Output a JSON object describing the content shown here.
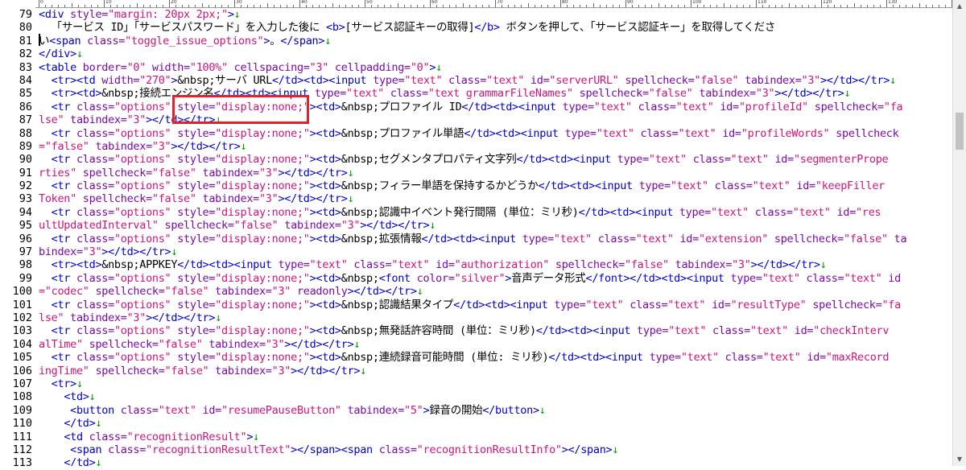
{
  "ruler_labels": [
    "0",
    "10",
    "20",
    "30",
    "40",
    "50",
    "60",
    "70",
    "80",
    "90",
    "100",
    "110",
    "120",
    "130"
  ],
  "line_numbers": [
    "79",
    "80",
    "81",
    "82",
    "83",
    "84",
    "85",
    "86",
    "87",
    "88",
    "89",
    "90",
    "91",
    "92",
    "93",
    "94",
    "95",
    "96",
    "97",
    "98",
    "99",
    "100",
    "101",
    "102",
    "103",
    "104",
    "105",
    "106",
    "107",
    "108",
    "109",
    "110",
    "111",
    "112",
    "113"
  ],
  "colors": {
    "tag": "#0000cc",
    "attr": "#7a0aa8",
    "value": "#d0147a",
    "text": "#000000",
    "eol_arrow": "#00a000",
    "highlight_border": "#e5202e"
  },
  "code_lines": [
    [
      [
        "t",
        "<div"
      ],
      [
        "a",
        " style="
      ],
      [
        "v",
        "\"margin: 20px 2px;\""
      ],
      [
        "t",
        ">"
      ],
      [
        "e",
        "↓"
      ]
    ],
    [
      [
        "x",
        "  「サービス ID」「サービスパスワード」を入力した後に "
      ],
      [
        "t",
        "<b>"
      ],
      [
        "x",
        "[サービス認証キーの取得]"
      ],
      [
        "t",
        "</b>"
      ],
      [
        "x",
        " ボタンを押して、「サービス認証キー」を取得してくださ"
      ]
    ],
    [
      [
        "x",
        "い"
      ],
      [
        "t",
        "<span"
      ],
      [
        "a",
        " class="
      ],
      [
        "v",
        "\"toggle_issue_options\""
      ],
      [
        "t",
        ">"
      ],
      [
        "x",
        "。"
      ],
      [
        "t",
        "</span>"
      ],
      [
        "e",
        "↓"
      ]
    ],
    [
      [
        "t",
        "</div>"
      ],
      [
        "e",
        "↓"
      ]
    ],
    [
      [
        "t",
        "<table"
      ],
      [
        "a",
        " border="
      ],
      [
        "v",
        "\"0\""
      ],
      [
        "a",
        " width="
      ],
      [
        "v",
        "\"100%\""
      ],
      [
        "a",
        " cellspacing="
      ],
      [
        "v",
        "\"3\""
      ],
      [
        "a",
        " cellpadding="
      ],
      [
        "v",
        "\"0\""
      ],
      [
        "t",
        ">"
      ],
      [
        "e",
        "↓"
      ]
    ],
    [
      [
        "x",
        "  "
      ],
      [
        "t",
        "<tr><td"
      ],
      [
        "a",
        " width="
      ],
      [
        "v",
        "\"270\""
      ],
      [
        "t",
        ">"
      ],
      [
        "x",
        "&nbsp;サーバ URL"
      ],
      [
        "t",
        "</td><td><input"
      ],
      [
        "a",
        " type="
      ],
      [
        "v",
        "\"text\""
      ],
      [
        "a",
        " class="
      ],
      [
        "v",
        "\"text\""
      ],
      [
        "a",
        " id="
      ],
      [
        "v",
        "\"serverURL\""
      ],
      [
        "a",
        " spellcheck="
      ],
      [
        "v",
        "\"false\""
      ],
      [
        "a",
        " tabindex="
      ],
      [
        "v",
        "\"3\""
      ],
      [
        "t",
        "></td></tr>"
      ],
      [
        "e",
        "↓"
      ]
    ],
    [
      [
        "x",
        "  "
      ],
      [
        "t",
        "<tr><td>"
      ],
      [
        "x",
        "&nbsp;接続エンジン名"
      ],
      [
        "t",
        "</td><td><input"
      ],
      [
        "a",
        " type="
      ],
      [
        "v",
        "\"text\""
      ],
      [
        "a",
        " class="
      ],
      [
        "v",
        "\"text grammarFileNames\""
      ],
      [
        "a",
        " spellcheck="
      ],
      [
        "v",
        "\"false\""
      ],
      [
        "a",
        " tabindex="
      ],
      [
        "v",
        "\"3\""
      ],
      [
        "t",
        "></td></tr>"
      ],
      [
        "e",
        "↓"
      ]
    ],
    [
      [
        "x",
        "  "
      ],
      [
        "t",
        "<tr"
      ],
      [
        "a",
        " class="
      ],
      [
        "v",
        "\"options\""
      ],
      [
        "a",
        " style="
      ],
      [
        "v",
        "\"display:none;\""
      ],
      [
        "t",
        "><td>"
      ],
      [
        "x",
        "&nbsp;プロファイル ID"
      ],
      [
        "t",
        "</td><td><input"
      ],
      [
        "a",
        " type="
      ],
      [
        "v",
        "\"text\""
      ],
      [
        "a",
        " class="
      ],
      [
        "v",
        "\"text\""
      ],
      [
        "a",
        " id="
      ],
      [
        "v",
        "\"profileId\""
      ],
      [
        "a",
        " spellcheck="
      ],
      [
        "v",
        "\"fa"
      ]
    ],
    [
      [
        "v",
        "lse\""
      ],
      [
        "a",
        " tabindex="
      ],
      [
        "v",
        "\"3\""
      ],
      [
        "t",
        "></td></tr>"
      ],
      [
        "e",
        "↓"
      ]
    ],
    [
      [
        "x",
        "  "
      ],
      [
        "t",
        "<tr"
      ],
      [
        "a",
        " class="
      ],
      [
        "v",
        "\"options\""
      ],
      [
        "a",
        " style="
      ],
      [
        "v",
        "\"display:none;\""
      ],
      [
        "t",
        "><td>"
      ],
      [
        "x",
        "&nbsp;プロファイル単語"
      ],
      [
        "t",
        "</td><td><input"
      ],
      [
        "a",
        " type="
      ],
      [
        "v",
        "\"text\""
      ],
      [
        "a",
        " class="
      ],
      [
        "v",
        "\"text\""
      ],
      [
        "a",
        " id="
      ],
      [
        "v",
        "\"profileWords\""
      ],
      [
        "a",
        " spellcheck"
      ]
    ],
    [
      [
        "v",
        "=\"false\""
      ],
      [
        "a",
        " tabindex="
      ],
      [
        "v",
        "\"3\""
      ],
      [
        "t",
        "></td></tr>"
      ],
      [
        "e",
        "↓"
      ]
    ],
    [
      [
        "x",
        "  "
      ],
      [
        "t",
        "<tr"
      ],
      [
        "a",
        " class="
      ],
      [
        "v",
        "\"options\""
      ],
      [
        "a",
        " style="
      ],
      [
        "v",
        "\"display:none;\""
      ],
      [
        "t",
        "><td>"
      ],
      [
        "x",
        "&nbsp;セグメンタプロパティ文字列"
      ],
      [
        "t",
        "</td><td><input"
      ],
      [
        "a",
        " type="
      ],
      [
        "v",
        "\"text\""
      ],
      [
        "a",
        " class="
      ],
      [
        "v",
        "\"text\""
      ],
      [
        "a",
        " id="
      ],
      [
        "v",
        "\"segmenterPrope"
      ]
    ],
    [
      [
        "v",
        "rties\""
      ],
      [
        "a",
        " spellcheck="
      ],
      [
        "v",
        "\"false\""
      ],
      [
        "a",
        " tabindex="
      ],
      [
        "v",
        "\"3\""
      ],
      [
        "t",
        "></td></tr>"
      ],
      [
        "e",
        "↓"
      ]
    ],
    [
      [
        "x",
        "  "
      ],
      [
        "t",
        "<tr"
      ],
      [
        "a",
        " class="
      ],
      [
        "v",
        "\"options\""
      ],
      [
        "a",
        " style="
      ],
      [
        "v",
        "\"display:none;\""
      ],
      [
        "t",
        "><td>"
      ],
      [
        "x",
        "&nbsp;フィラー単語を保持するかどうか"
      ],
      [
        "t",
        "</td><td><input"
      ],
      [
        "a",
        " type="
      ],
      [
        "v",
        "\"text\""
      ],
      [
        "a",
        " class="
      ],
      [
        "v",
        "\"text\""
      ],
      [
        "a",
        " id="
      ],
      [
        "v",
        "\"keepFiller"
      ]
    ],
    [
      [
        "v",
        "Token\""
      ],
      [
        "a",
        " spellcheck="
      ],
      [
        "v",
        "\"false\""
      ],
      [
        "a",
        " tabindex="
      ],
      [
        "v",
        "\"3\""
      ],
      [
        "t",
        "></td></tr>"
      ],
      [
        "e",
        "↓"
      ]
    ],
    [
      [
        "x",
        "  "
      ],
      [
        "t",
        "<tr"
      ],
      [
        "a",
        " class="
      ],
      [
        "v",
        "\"options\""
      ],
      [
        "a",
        " style="
      ],
      [
        "v",
        "\"display:none;\""
      ],
      [
        "t",
        "><td>"
      ],
      [
        "x",
        "&nbsp;認識中イベント発行間隔 (単位：ミリ秒)"
      ],
      [
        "t",
        "</td><td><input"
      ],
      [
        "a",
        " type="
      ],
      [
        "v",
        "\"text\""
      ],
      [
        "a",
        " class="
      ],
      [
        "v",
        "\"text\""
      ],
      [
        "a",
        " id="
      ],
      [
        "v",
        "\"res"
      ]
    ],
    [
      [
        "v",
        "ultUpdatedInterval\""
      ],
      [
        "a",
        " spellcheck="
      ],
      [
        "v",
        "\"false\""
      ],
      [
        "a",
        " tabindex="
      ],
      [
        "v",
        "\"3\""
      ],
      [
        "t",
        "></td></tr>"
      ],
      [
        "e",
        "↓"
      ]
    ],
    [
      [
        "x",
        "  "
      ],
      [
        "t",
        "<tr"
      ],
      [
        "a",
        " class="
      ],
      [
        "v",
        "\"options\""
      ],
      [
        "a",
        " style="
      ],
      [
        "v",
        "\"display:none;\""
      ],
      [
        "t",
        "><td>"
      ],
      [
        "x",
        "&nbsp;拡張情報"
      ],
      [
        "t",
        "</td><td><input"
      ],
      [
        "a",
        " type="
      ],
      [
        "v",
        "\"text\""
      ],
      [
        "a",
        " class="
      ],
      [
        "v",
        "\"text\""
      ],
      [
        "a",
        " id="
      ],
      [
        "v",
        "\"extension\""
      ],
      [
        "a",
        " spellcheck="
      ],
      [
        "v",
        "\"false\""
      ],
      [
        "a",
        " ta"
      ]
    ],
    [
      [
        "a",
        "bindex="
      ],
      [
        "v",
        "\"3\""
      ],
      [
        "t",
        "></td></tr>"
      ],
      [
        "e",
        "↓"
      ]
    ],
    [
      [
        "x",
        "  "
      ],
      [
        "t",
        "<tr><td>"
      ],
      [
        "x",
        "&nbsp;APPKEY"
      ],
      [
        "t",
        "</td><td><input"
      ],
      [
        "a",
        " type="
      ],
      [
        "v",
        "\"text\""
      ],
      [
        "a",
        " class="
      ],
      [
        "v",
        "\"text\""
      ],
      [
        "a",
        " id="
      ],
      [
        "v",
        "\"authorization\""
      ],
      [
        "a",
        " spellcheck="
      ],
      [
        "v",
        "\"false\""
      ],
      [
        "a",
        " tabindex="
      ],
      [
        "v",
        "\"3\""
      ],
      [
        "t",
        "></td></tr>"
      ],
      [
        "e",
        "↓"
      ]
    ],
    [
      [
        "x",
        "  "
      ],
      [
        "t",
        "<tr"
      ],
      [
        "a",
        " class="
      ],
      [
        "v",
        "\"options\""
      ],
      [
        "a",
        " style="
      ],
      [
        "v",
        "\"display:none;\""
      ],
      [
        "t",
        "><td>"
      ],
      [
        "x",
        "&nbsp;"
      ],
      [
        "t",
        "<font"
      ],
      [
        "a",
        " color="
      ],
      [
        "v",
        "\"silver\""
      ],
      [
        "t",
        ">"
      ],
      [
        "x",
        "音声データ形式"
      ],
      [
        "t",
        "</font></td><td><input"
      ],
      [
        "a",
        " type="
      ],
      [
        "v",
        "\"text\""
      ],
      [
        "a",
        " class="
      ],
      [
        "v",
        "\"text\""
      ],
      [
        "a",
        " id"
      ]
    ],
    [
      [
        "v",
        "=\"codec\""
      ],
      [
        "a",
        " spellcheck="
      ],
      [
        "v",
        "\"false\""
      ],
      [
        "a",
        " tabindex="
      ],
      [
        "v",
        "\"3\""
      ],
      [
        "a",
        " readonly"
      ],
      [
        "t",
        "></td></tr>"
      ],
      [
        "e",
        "↓"
      ]
    ],
    [
      [
        "x",
        "  "
      ],
      [
        "t",
        "<tr"
      ],
      [
        "a",
        " class="
      ],
      [
        "v",
        "\"options\""
      ],
      [
        "a",
        " style="
      ],
      [
        "v",
        "\"display:none;\""
      ],
      [
        "t",
        "><td>"
      ],
      [
        "x",
        "&nbsp;認識結果タイプ"
      ],
      [
        "t",
        "</td><td><input"
      ],
      [
        "a",
        " type="
      ],
      [
        "v",
        "\"text\""
      ],
      [
        "a",
        " class="
      ],
      [
        "v",
        "\"text\""
      ],
      [
        "a",
        " id="
      ],
      [
        "v",
        "\"resultType\""
      ],
      [
        "a",
        " spellcheck="
      ],
      [
        "v",
        "\"fa"
      ]
    ],
    [
      [
        "v",
        "lse\""
      ],
      [
        "a",
        " tabindex="
      ],
      [
        "v",
        "\"3\""
      ],
      [
        "t",
        "></td></tr>"
      ],
      [
        "e",
        "↓"
      ]
    ],
    [
      [
        "x",
        "  "
      ],
      [
        "t",
        "<tr"
      ],
      [
        "a",
        " class="
      ],
      [
        "v",
        "\"options\""
      ],
      [
        "a",
        " style="
      ],
      [
        "v",
        "\"display:none;\""
      ],
      [
        "t",
        "><td>"
      ],
      [
        "x",
        "&nbsp;無発話許容時間 (単位：ミリ秒)"
      ],
      [
        "t",
        "</td><td><input"
      ],
      [
        "a",
        " type="
      ],
      [
        "v",
        "\"text\""
      ],
      [
        "a",
        " class="
      ],
      [
        "v",
        "\"text\""
      ],
      [
        "a",
        " id="
      ],
      [
        "v",
        "\"checkInterv"
      ]
    ],
    [
      [
        "v",
        "alTime\""
      ],
      [
        "a",
        " spellcheck="
      ],
      [
        "v",
        "\"false\""
      ],
      [
        "a",
        " tabindex="
      ],
      [
        "v",
        "\"3\""
      ],
      [
        "t",
        "></td></tr>"
      ],
      [
        "e",
        "↓"
      ]
    ],
    [
      [
        "x",
        "  "
      ],
      [
        "t",
        "<tr"
      ],
      [
        "a",
        " class="
      ],
      [
        "v",
        "\"options\""
      ],
      [
        "a",
        " style="
      ],
      [
        "v",
        "\"display:none;\""
      ],
      [
        "t",
        "><td>"
      ],
      [
        "x",
        "&nbsp;連続録音可能時間 (単位: ミリ秒)"
      ],
      [
        "t",
        "</td><td><input"
      ],
      [
        "a",
        " type="
      ],
      [
        "v",
        "\"text\""
      ],
      [
        "a",
        " class="
      ],
      [
        "v",
        "\"text\""
      ],
      [
        "a",
        " id="
      ],
      [
        "v",
        "\"maxRecord"
      ]
    ],
    [
      [
        "v",
        "ingTime\""
      ],
      [
        "a",
        " spellcheck="
      ],
      [
        "v",
        "\"false\""
      ],
      [
        "a",
        " tabindex="
      ],
      [
        "v",
        "\"3\""
      ],
      [
        "t",
        "></td></tr>"
      ],
      [
        "e",
        "↓"
      ]
    ],
    [
      [
        "x",
        "  "
      ],
      [
        "t",
        "<tr>"
      ],
      [
        "e",
        "↓"
      ]
    ],
    [
      [
        "x",
        "    "
      ],
      [
        "t",
        "<td>"
      ],
      [
        "e",
        "↓"
      ]
    ],
    [
      [
        "x",
        "     "
      ],
      [
        "t",
        "<button"
      ],
      [
        "a",
        " class="
      ],
      [
        "v",
        "\"text\""
      ],
      [
        "a",
        " id="
      ],
      [
        "v",
        "\"resumePauseButton\""
      ],
      [
        "a",
        " tabindex="
      ],
      [
        "v",
        "\"5\""
      ],
      [
        "t",
        ">"
      ],
      [
        "x",
        "録音の開始"
      ],
      [
        "t",
        "</button>"
      ],
      [
        "e",
        "↓"
      ]
    ],
    [
      [
        "x",
        "    "
      ],
      [
        "t",
        "</td>"
      ],
      [
        "e",
        "↓"
      ]
    ],
    [
      [
        "x",
        "    "
      ],
      [
        "t",
        "<td"
      ],
      [
        "a",
        " class="
      ],
      [
        "v",
        "\"recognitionResult\""
      ],
      [
        "t",
        ">"
      ],
      [
        "e",
        "↓"
      ]
    ],
    [
      [
        "x",
        "     "
      ],
      [
        "t",
        "<span"
      ],
      [
        "a",
        " class="
      ],
      [
        "v",
        "\"recognitionResultText\""
      ],
      [
        "t",
        "></span><span"
      ],
      [
        "a",
        " class="
      ],
      [
        "v",
        "\"recognitionResultInfo\""
      ],
      [
        "t",
        "></span>"
      ],
      [
        "e",
        "↓"
      ]
    ],
    [
      [
        "x",
        "    "
      ],
      [
        "t",
        "</td>"
      ],
      [
        "e",
        "↓"
      ]
    ]
  ],
  "icons": {
    "scroll_up": "triangle-up",
    "scroll_down": "triangle-down"
  }
}
